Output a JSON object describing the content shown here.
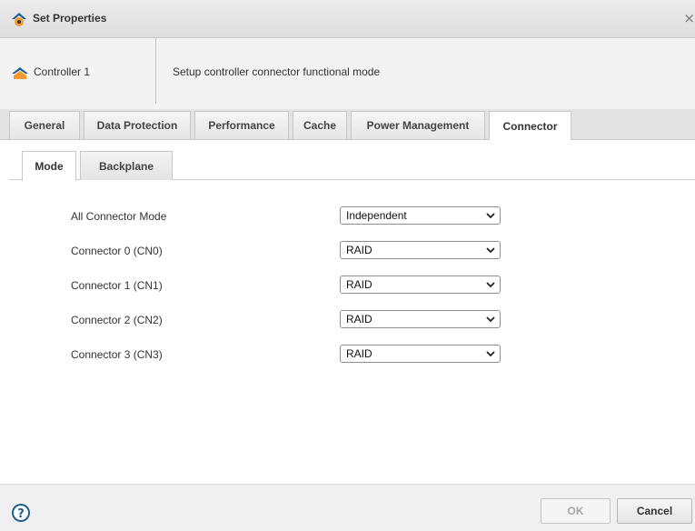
{
  "dialog": {
    "title": "Set Properties",
    "close_glyph": "×"
  },
  "info": {
    "controller_name": "Controller 1",
    "description": "Setup controller connector functional mode"
  },
  "tabs": [
    {
      "label": "General",
      "active": false
    },
    {
      "label": "Data Protection",
      "active": false
    },
    {
      "label": "Performance",
      "active": false
    },
    {
      "label": "Cache",
      "active": false
    },
    {
      "label": "Power Management",
      "active": false
    },
    {
      "label": "Connector",
      "active": true
    }
  ],
  "subtabs": [
    {
      "label": "Mode",
      "active": true
    },
    {
      "label": "Backplane",
      "active": false
    }
  ],
  "settings": [
    {
      "label": "All Connector Mode",
      "value": "Independent"
    },
    {
      "label": "Connector 0 (CN0)",
      "value": "RAID"
    },
    {
      "label": "Connector 1 (CN1)",
      "value": "RAID"
    },
    {
      "label": "Connector 2 (CN2)",
      "value": "RAID"
    },
    {
      "label": "Connector 3 (CN3)",
      "value": "RAID"
    }
  ],
  "footer": {
    "ok_label": "OK",
    "cancel_label": "Cancel",
    "ok_enabled": false
  },
  "icons": {
    "title": "settings-gear-icon",
    "controller": "controller-icon",
    "help": "help-icon",
    "dropdown": "chevron-down-icon",
    "close": "close-icon"
  },
  "colors": {
    "accent": "#1d5f8f",
    "gear_orange": "#f29a2e"
  }
}
